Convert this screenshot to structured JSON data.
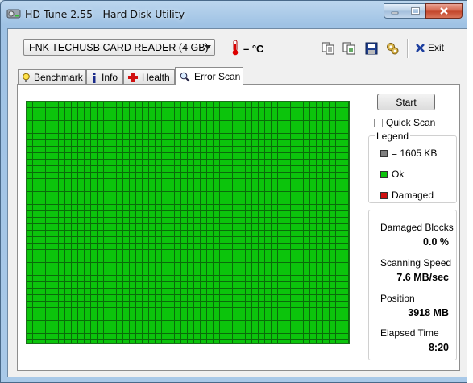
{
  "window": {
    "title": "HD Tune 2.55 - Hard Disk Utility"
  },
  "toolbar": {
    "drive": "FNK TECHUSB CARD READER (4 GB)",
    "temperature": "– °C",
    "exit_label": "Exit",
    "icons": [
      "copy-info-icon",
      "copy-screenshot-icon",
      "save-icon",
      "options-icon"
    ]
  },
  "tabs": [
    {
      "label": "Benchmark",
      "icon": "lightbulb-icon"
    },
    {
      "label": "Info",
      "icon": "info-icon"
    },
    {
      "label": "Health",
      "icon": "health-cross-icon"
    },
    {
      "label": "Error Scan",
      "icon": "magnifier-icon",
      "active": true
    }
  ],
  "scan": {
    "start_label": "Start",
    "quick_scan_label": "Quick Scan",
    "quick_scan_checked": false
  },
  "legend": {
    "title": "Legend",
    "items": [
      {
        "label": "= 1605 KB",
        "color": "#808080"
      },
      {
        "label": "Ok",
        "color": "#0cc40c"
      },
      {
        "label": "Damaged",
        "color": "#d01010"
      }
    ]
  },
  "stats": {
    "damaged_blocks_label": "Damaged Blocks",
    "damaged_blocks_value": "0.0 %",
    "speed_label": "Scanning Speed",
    "speed_value": "7.6 MB/sec",
    "position_label": "Position",
    "position_value": "3918 MB",
    "elapsed_label": "Elapsed Time",
    "elapsed_value": "8:20"
  },
  "colors": {
    "ok": "#0cc40c",
    "grid_line": "#0a6b0a",
    "damaged": "#d01010"
  }
}
